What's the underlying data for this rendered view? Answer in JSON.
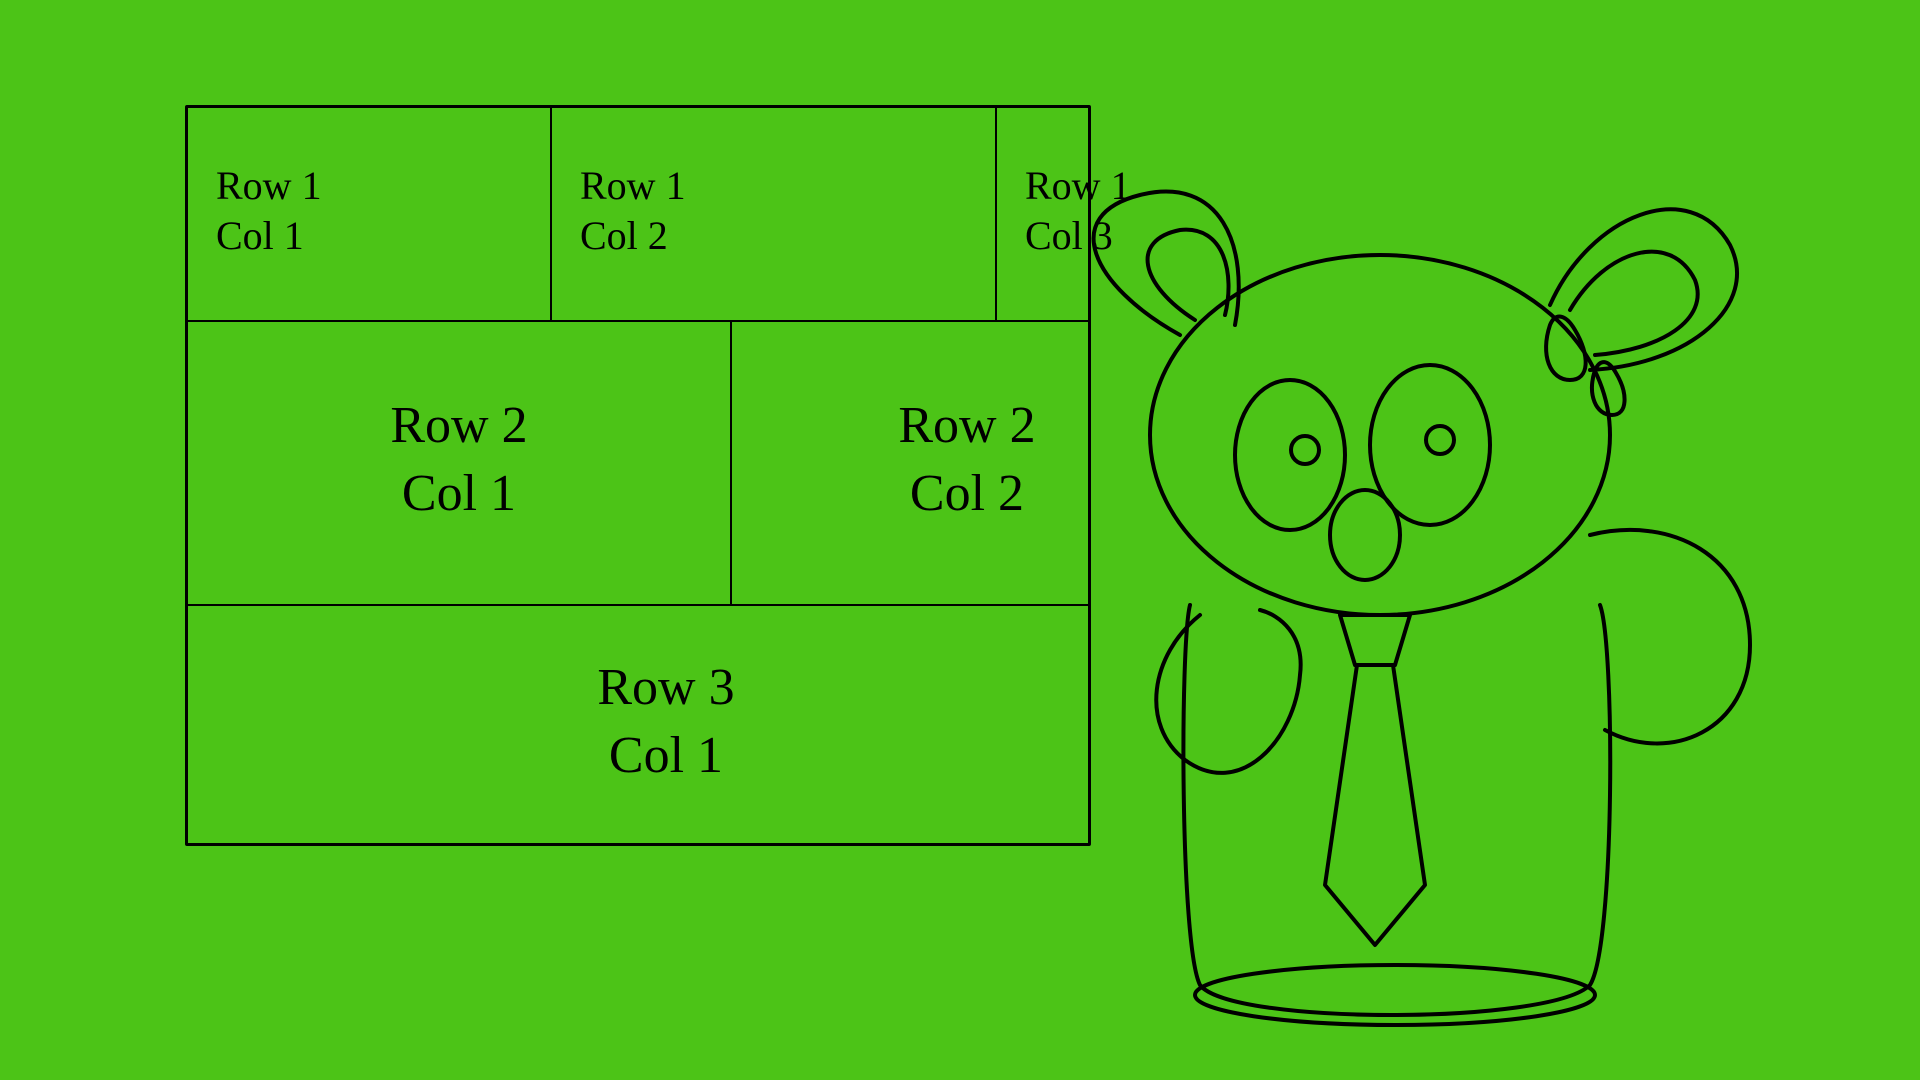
{
  "table": {
    "rows": [
      {
        "cells": [
          {
            "line1": "Row 1",
            "line2": "Col 1"
          },
          {
            "line1": "Row 1",
            "line2": "Col 2"
          },
          {
            "line1": "Row 1",
            "line2": "Col 3"
          }
        ]
      },
      {
        "cells": [
          {
            "line1": "Row 2",
            "line2": "Col 1"
          },
          {
            "line1": "Row 2",
            "line2": "Col 2"
          }
        ]
      },
      {
        "cells": [
          {
            "line1": "Row 3",
            "line2": "Col 1"
          }
        ]
      }
    ]
  },
  "illustration": {
    "name": "koala-character"
  }
}
